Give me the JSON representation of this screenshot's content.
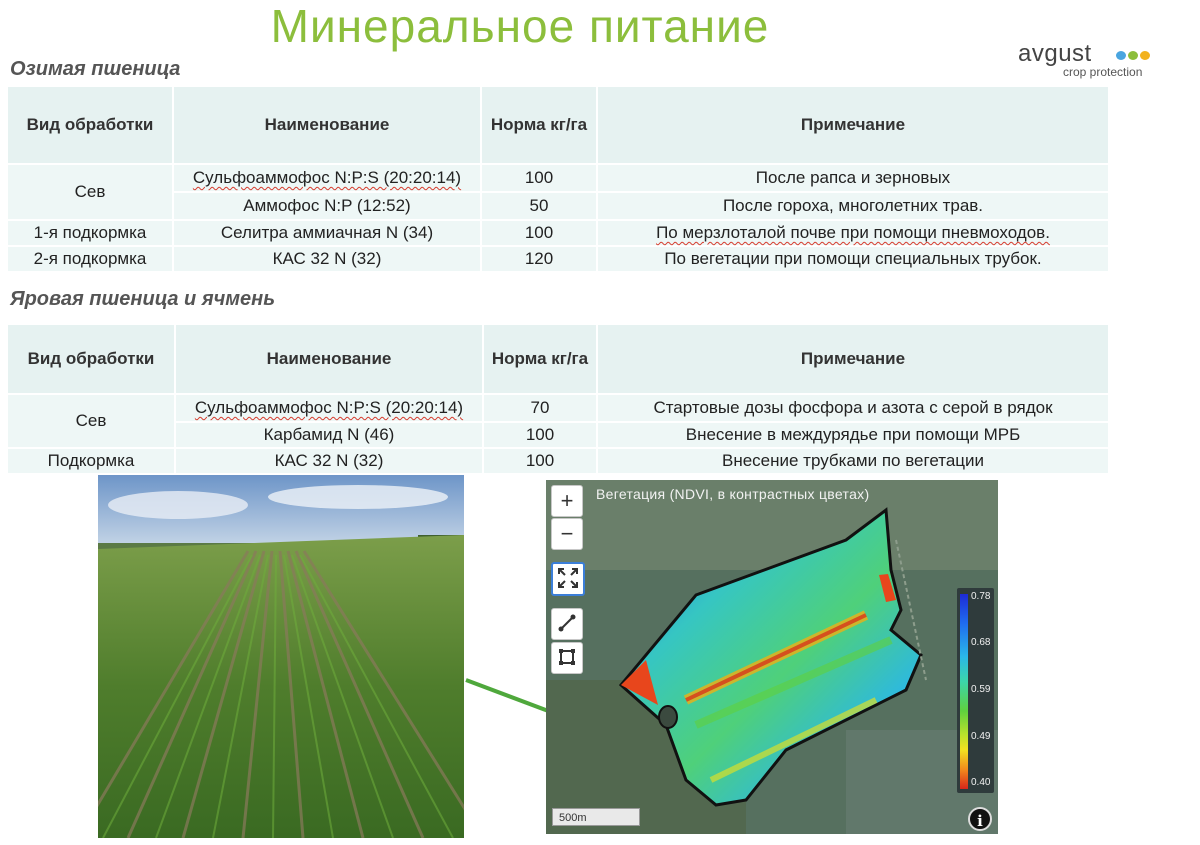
{
  "page": {
    "title": "Минеральное питание",
    "logo": {
      "word": "avgust",
      "subtitle": "crop protection",
      "dot_colors": [
        "#4aa5e0",
        "#8cbe3c",
        "#f2b21e"
      ]
    }
  },
  "winter": {
    "heading": "Озимая пшеница",
    "headers": [
      "Вид обработки",
      "Наименование",
      "Норма кг/га",
      "Примечание"
    ],
    "rows": [
      {
        "type": "Сев",
        "name": "Сульфоаммофос N:P:S (20:20:14)",
        "rate": "100",
        "note": "После рапса и зерновых"
      },
      {
        "type": "",
        "name": "Аммофос N:P (12:52)",
        "rate": "50",
        "note": "После гороха, многолетних трав."
      },
      {
        "type": "1-я подкормка",
        "name": "Селитра аммиачная N (34)",
        "rate": "100",
        "note": "По мерзлоталой почве при помощи пневмоходов."
      },
      {
        "type": "2-я подкормка",
        "name": "КАС 32 N (32)",
        "rate": "120",
        "note": "По вегетации при помощи специальных трубок."
      }
    ]
  },
  "spring": {
    "heading": "Яровая пшеница и ячмень",
    "headers": [
      "Вид обработки",
      "Наименование",
      "Норма кг/га",
      "Примечание"
    ],
    "rows": [
      {
        "type": "Сев",
        "name": "Сульфоаммофос N:P:S (20:20:14)",
        "rate": "70",
        "note": "Стартовые дозы фосфора и азота с серой в рядок"
      },
      {
        "type": "",
        "name": "Карбамид N (46)",
        "rate": "100",
        "note": "Внесение в междурядье при помощи МРБ"
      },
      {
        "type": "Подкормка",
        "name": "КАС 32 N (32)",
        "rate": "100",
        "note": "Внесение трубками по вегетации"
      }
    ]
  },
  "map": {
    "title": "Вегетация (NDVI, в контрастных цветах)",
    "zoom_in": "+",
    "zoom_out": "−",
    "legend": [
      "0.78",
      "0.68",
      "0.59",
      "0.49",
      "0.40"
    ],
    "scale": "500m",
    "info": "i"
  }
}
